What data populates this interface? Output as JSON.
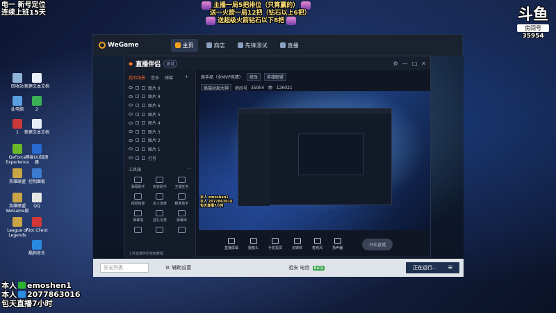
{
  "overlay": {
    "top_left": [
      "电一 新号定位",
      "连续上班15天"
    ],
    "top_center": [
      "主播一局5把排位（只算赢的）",
      "送一火箭一局12把（钻石以上6把）",
      "送超级火箭钻石以下8把"
    ],
    "brand": {
      "logo": "斗鱼",
      "room_label": "房间号",
      "room_id": "35954"
    },
    "bottom_left": [
      {
        "prefix": "本人",
        "value": "emoshen1",
        "icon_color": "#2fb52f"
      },
      {
        "prefix": "本人",
        "value": "2077863016",
        "icon_color": "#2a8fe0"
      },
      {
        "prefix": "包天直播7小时",
        "value": "",
        "icon_color": ""
      }
    ]
  },
  "desktop": {
    "icons": [
      {
        "label": "回收站",
        "color": "#8fb3d8"
      },
      {
        "label": "新建文本文档",
        "color": "#e8eef6"
      },
      {
        "label": "此电脑",
        "color": "#5aa0e0"
      },
      {
        "label": "2",
        "color": "#3cb054"
      },
      {
        "label": "1",
        "color": "#c83a3a"
      },
      {
        "label": "新建文本文档",
        "color": "#e8eef6"
      },
      {
        "label": "GeForce Experience",
        "color": "#6ab82a"
      },
      {
        "label": "网易UU加速器",
        "color": "#2a6ad0"
      },
      {
        "label": "英雄联盟",
        "color": "#c9a545"
      },
      {
        "label": "控制面板",
        "color": "#3a7ad0"
      },
      {
        "label": "英雄联盟WeGame版",
        "color": "#c9a545"
      },
      {
        "label": "QQ",
        "color": "#e6e6e6"
      },
      {
        "label": "League of Legends",
        "color": "#c9a545"
      },
      {
        "label": "Riot Client",
        "color": "#d13639"
      },
      {
        "label": "酷狗音乐",
        "color": "#2a8ae0"
      }
    ]
  },
  "wegame": {
    "logo": "WeGame",
    "tabs": [
      {
        "label": "主页",
        "active": true
      },
      {
        "label": "商店",
        "active": false
      },
      {
        "label": "先锋测试",
        "active": false
      },
      {
        "label": "直播",
        "active": false
      }
    ],
    "bottom": {
      "input_placeholder": "好友列表",
      "aux_label": "辅助设置",
      "region_label": "祖安 电信",
      "badge": "Beta",
      "run_label": "正在运行..."
    }
  },
  "zhibo": {
    "title": "直播伴侣",
    "pill": "测试",
    "left_tabs": [
      {
        "label": "我的场景",
        "on": true
      },
      {
        "label": "音乐",
        "on": false
      },
      {
        "label": "弹幕",
        "on": false
      }
    ],
    "layers": [
      "图片 9",
      "图片 8",
      "图片 6",
      "图片 5",
      "图片 4",
      "图片 3",
      "图片 2",
      "图片 1",
      "打号"
    ],
    "tools_header": "工具箱",
    "tools": [
      "弹幕助手",
      "房管助手",
      "主播任务",
      "视频连麦",
      "多人连麦",
      "精准助手",
      "弹幕墙",
      "送礼记录",
      "弹幕库",
      "",
      "",
      ""
    ],
    "footer": "上传直播伴侣使用教程",
    "head": {
      "title_label": "高手局（全MVP竞猜）",
      "edit": "修改",
      "category": "英雄联盟",
      "tag": "高端对局大神",
      "room": "35954",
      "stats": "126021"
    },
    "preview_text": [
      "本人 emoshen1",
      "本人 2077863016",
      "包天直播7小时"
    ],
    "toolbar": [
      "直播屏幕",
      "摄像头",
      "手机投屏",
      "多媒体",
      "麦克风",
      "扬声器"
    ],
    "live_button": "开始直播"
  }
}
